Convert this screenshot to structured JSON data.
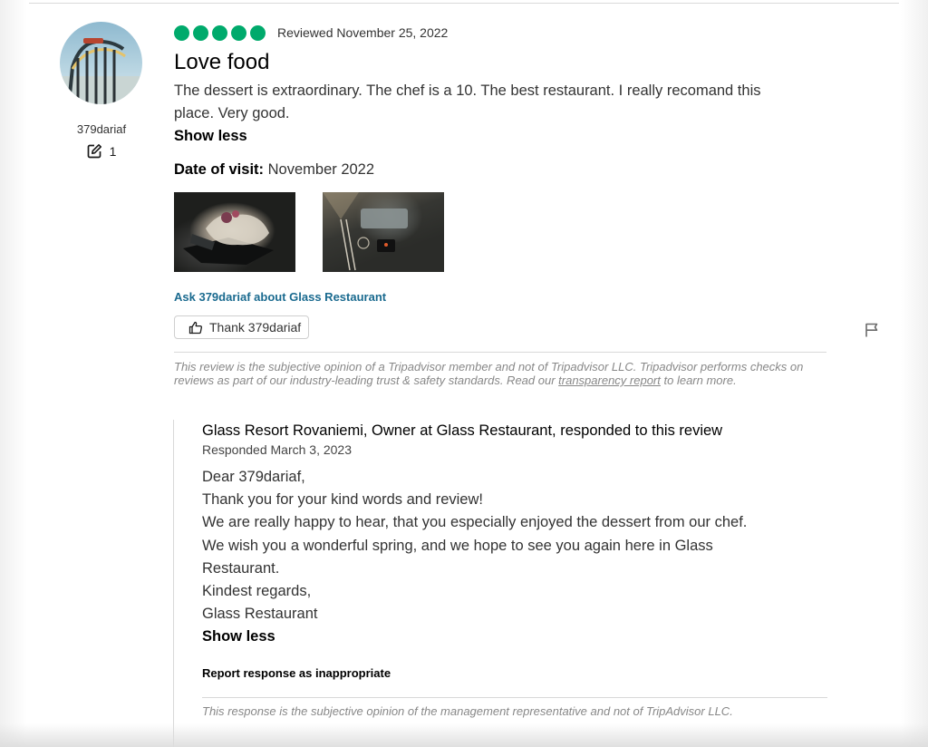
{
  "author": {
    "name": "379dariaf",
    "contributions": "1",
    "avatar_icon": "roller-coaster-photo"
  },
  "review": {
    "rating_bubbles": 5,
    "rating_color": "#00aa6c",
    "reviewed_date": "Reviewed November 25, 2022",
    "title": "Love food",
    "line1": "The dessert is extraordinary. The chef is a 10. The best restaurant. I really recomand this",
    "line2": "place. Very good.",
    "show_less": "Show less",
    "visit_label": "Date of visit:",
    "visit_value": "November 2022",
    "ask_link": "Ask 379dariaf about Glass Restaurant",
    "thank_button": "Thank 379dariaf",
    "disclaimer_pre": "This review is the subjective opinion of a Tripadvisor member and not of Tripadvisor LLC. Tripadvisor performs checks on reviews as part of our industry-leading trust & safety standards. Read our ",
    "disclaimer_link": "transparency report",
    "disclaimer_post": " to learn more."
  },
  "response": {
    "header": "Glass Resort Rovaniemi, Owner at Glass Restaurant, responded to this review",
    "date": "Responded March 3, 2023",
    "lines": [
      "Dear 379dariaf,",
      "Thank you for your kind words and review!",
      "We are really happy to hear, that you especially enjoyed the dessert from our chef.",
      "We wish you a wonderful spring, and we hope to see you again here in Glass",
      "Restaurant.",
      "Kindest regards,",
      "Glass Restaurant"
    ],
    "show_less": "Show less",
    "report": "Report response as inappropriate",
    "disclaimer": "This response is the subjective opinion of the management representative and not of TripAdvisor LLC."
  },
  "colors": {
    "link": "#1a6a8f",
    "rating": "#00aa6c"
  }
}
